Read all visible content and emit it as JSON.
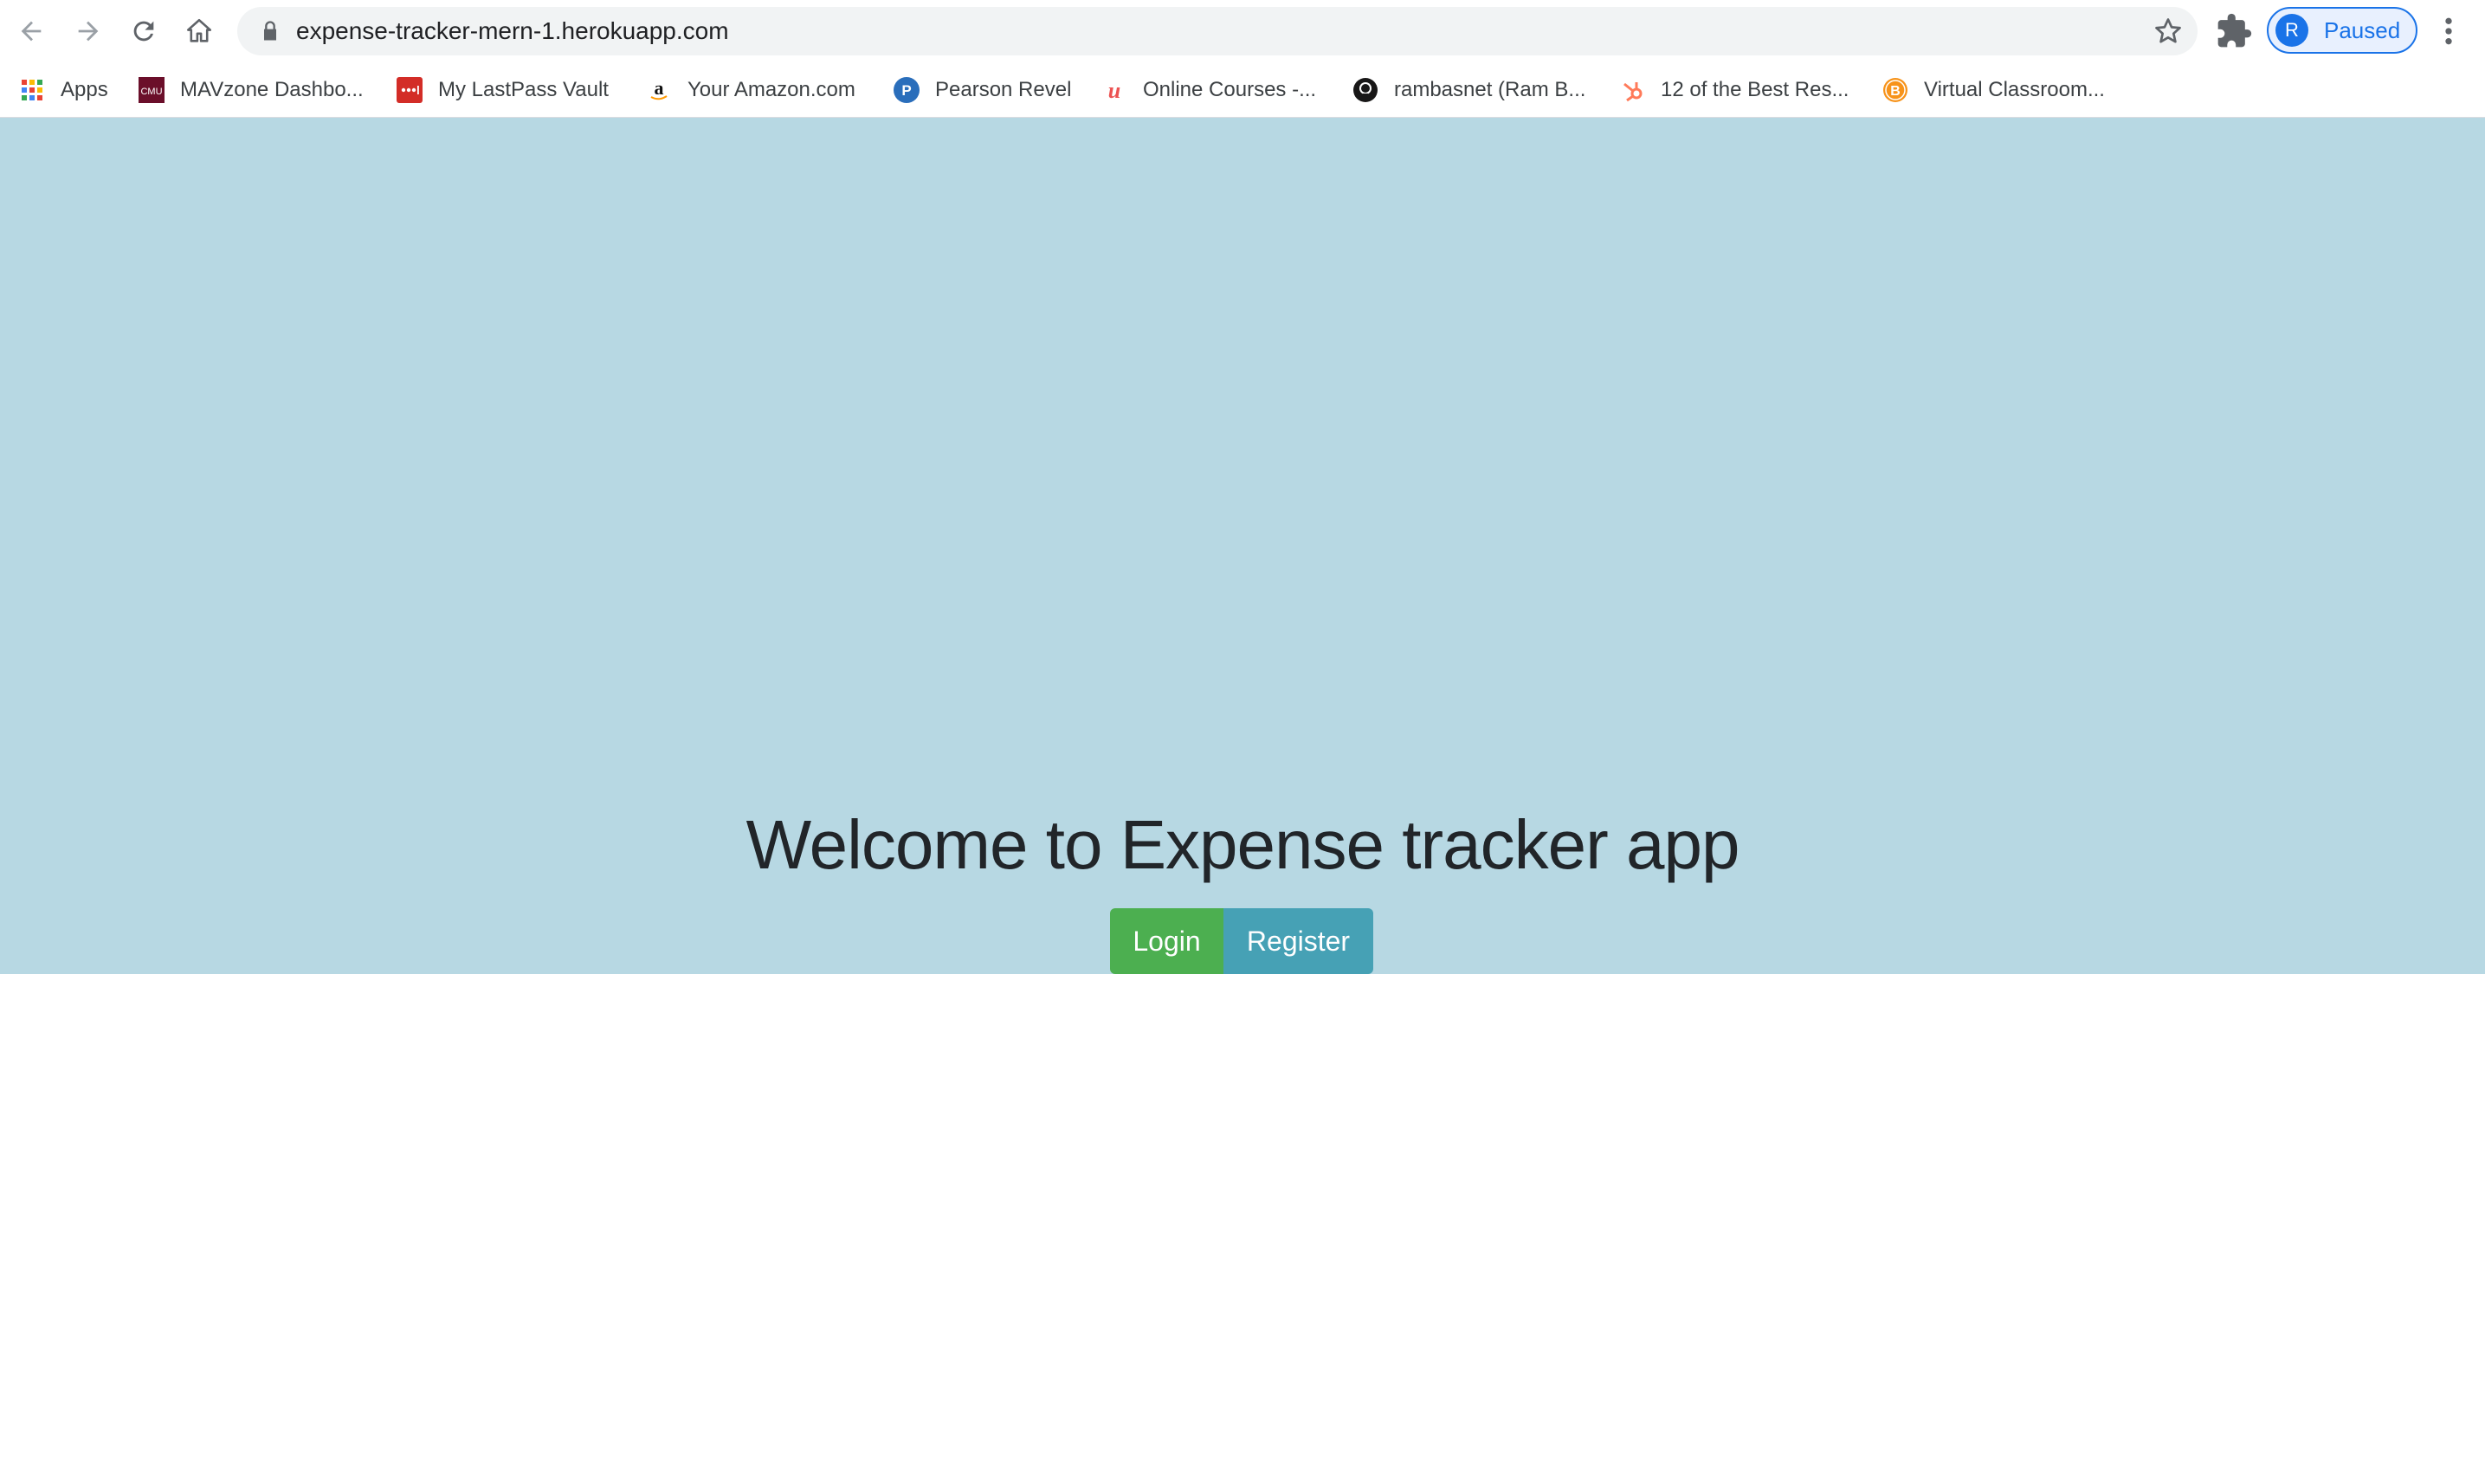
{
  "browser": {
    "url": "expense-tracker-mern-1.herokuapp.com",
    "profile_initial": "R",
    "profile_status": "Paused",
    "bookmarks": [
      {
        "label": "Apps",
        "icon": "apps-grid-icon"
      },
      {
        "label": "MAVzone Dashbo...",
        "icon": "cmu-icon"
      },
      {
        "label": "My LastPass Vault",
        "icon": "lastpass-icon"
      },
      {
        "label": "Your Amazon.com",
        "icon": "amazon-icon"
      },
      {
        "label": "Pearson Revel",
        "icon": "pearson-icon"
      },
      {
        "label": "Online Courses -...",
        "icon": "udemy-icon"
      },
      {
        "label": "rambasnet (Ram B...",
        "icon": "github-icon"
      },
      {
        "label": "12 of the Best Res...",
        "icon": "hubspot-icon"
      },
      {
        "label": "Virtual Classroom...",
        "icon": "bitcoin-icon"
      }
    ]
  },
  "page": {
    "title": "Welcome to Expense tracker app",
    "login_label": "Login",
    "register_label": "Register",
    "colors": {
      "hero_bg": "#b7d8e3",
      "login_bg": "#4caf50",
      "register_bg": "#46a1b5"
    }
  }
}
